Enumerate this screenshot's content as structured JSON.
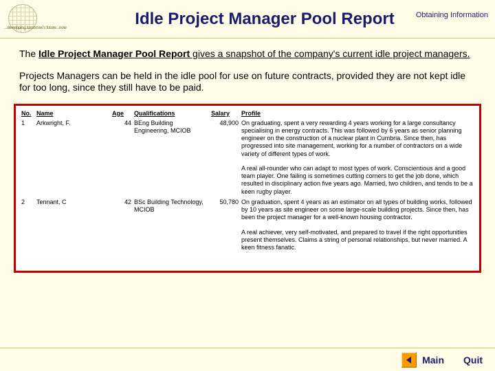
{
  "header": {
    "tagline": "...developing tomorrow's future...now",
    "page_title": "Idle Project Manager Pool Report",
    "breadcrumb": "Obtaining Information"
  },
  "intro": {
    "p1_prefix": "The ",
    "p1_bold": "Idle Project Manager Pool Report",
    "p1_rest": " gives a snapshot of the company's current idle project managers.",
    "p2": "Projects Managers can be held in the idle pool for use on future contracts, provided they are not kept idle for too long, since they still have to be paid."
  },
  "report": {
    "columns": {
      "no": "No.",
      "name": "Name",
      "age": "Age",
      "qual": "Qualifications",
      "salary": "Salary",
      "profile": "Profile"
    },
    "rows": [
      {
        "no": "1",
        "name": "Arkwright, F.",
        "age": "44",
        "qual": "BEng Building Engineering, MCIOB",
        "salary": "48,900",
        "profile_a": "On graduating, spent a very rewarding 4 years working for a large consultancy specialising in energy contracts. This was followed by 6 years as senior planning engineer on the construction of a nuclear plant in Cumbria. Since then, has progressed into site management, working for a number of contractors on a wide variety of different types of work.",
        "profile_b": "A real all-rounder who can adapt to most types of work. Conscientious and a good team player. One failing is sometimes cutting corners to get the job done, which resulted in disciplinary action five years ago. Married, two children, and tends to be a keen rugby player."
      },
      {
        "no": "2",
        "name": "Tennant, C",
        "age": "42",
        "qual": "BSc Building Technology, MCIOB",
        "salary": "50,780",
        "profile_a": "On graduation, spent 4 years as an estimator on all types of building works, followed by 10 years as site engineer on some large-scale building projects. Since then, has been the project manager for a well-known housing contractor.",
        "profile_b": "A real achiever, very self-motivated, and prepared to travel if the right opportunities present themselves. Claims a string of personal relationships, but never married. A keen fitness fanatic."
      }
    ]
  },
  "footer": {
    "main": "Main",
    "quit": "Quit"
  }
}
